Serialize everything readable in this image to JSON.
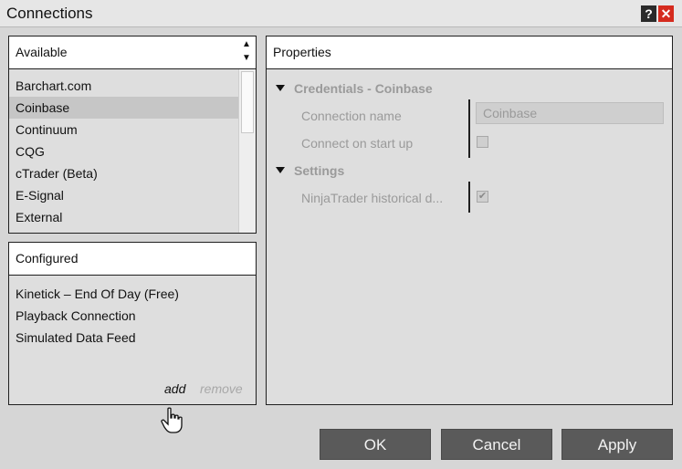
{
  "window": {
    "title": "Connections",
    "help_label": "?",
    "close_label": "✕"
  },
  "available": {
    "header": "Available",
    "items": [
      "Barchart.com",
      "Coinbase",
      "Continuum",
      "CQG",
      "cTrader (Beta)",
      "E-Signal",
      "External"
    ],
    "selected": "Coinbase"
  },
  "configured": {
    "header": "Configured",
    "items": [
      "Kinetick – End Of Day (Free)",
      "Playback Connection",
      "Simulated Data Feed"
    ],
    "add_label": "add",
    "remove_label": "remove"
  },
  "properties": {
    "header": "Properties",
    "credentials_section": "Credentials - Coinbase",
    "connection_name_label": "Connection name",
    "connection_name_value": "Coinbase",
    "connect_on_startup_label": "Connect on start up",
    "connect_on_startup_checked": false,
    "settings_section": "Settings",
    "historical_label": "NinjaTrader historical d...",
    "historical_checked": true
  },
  "buttons": {
    "ok": "OK",
    "cancel": "Cancel",
    "apply": "Apply"
  },
  "icons": {
    "cursor": "hand-pointer-icon",
    "expand": "triangle-down-icon"
  }
}
